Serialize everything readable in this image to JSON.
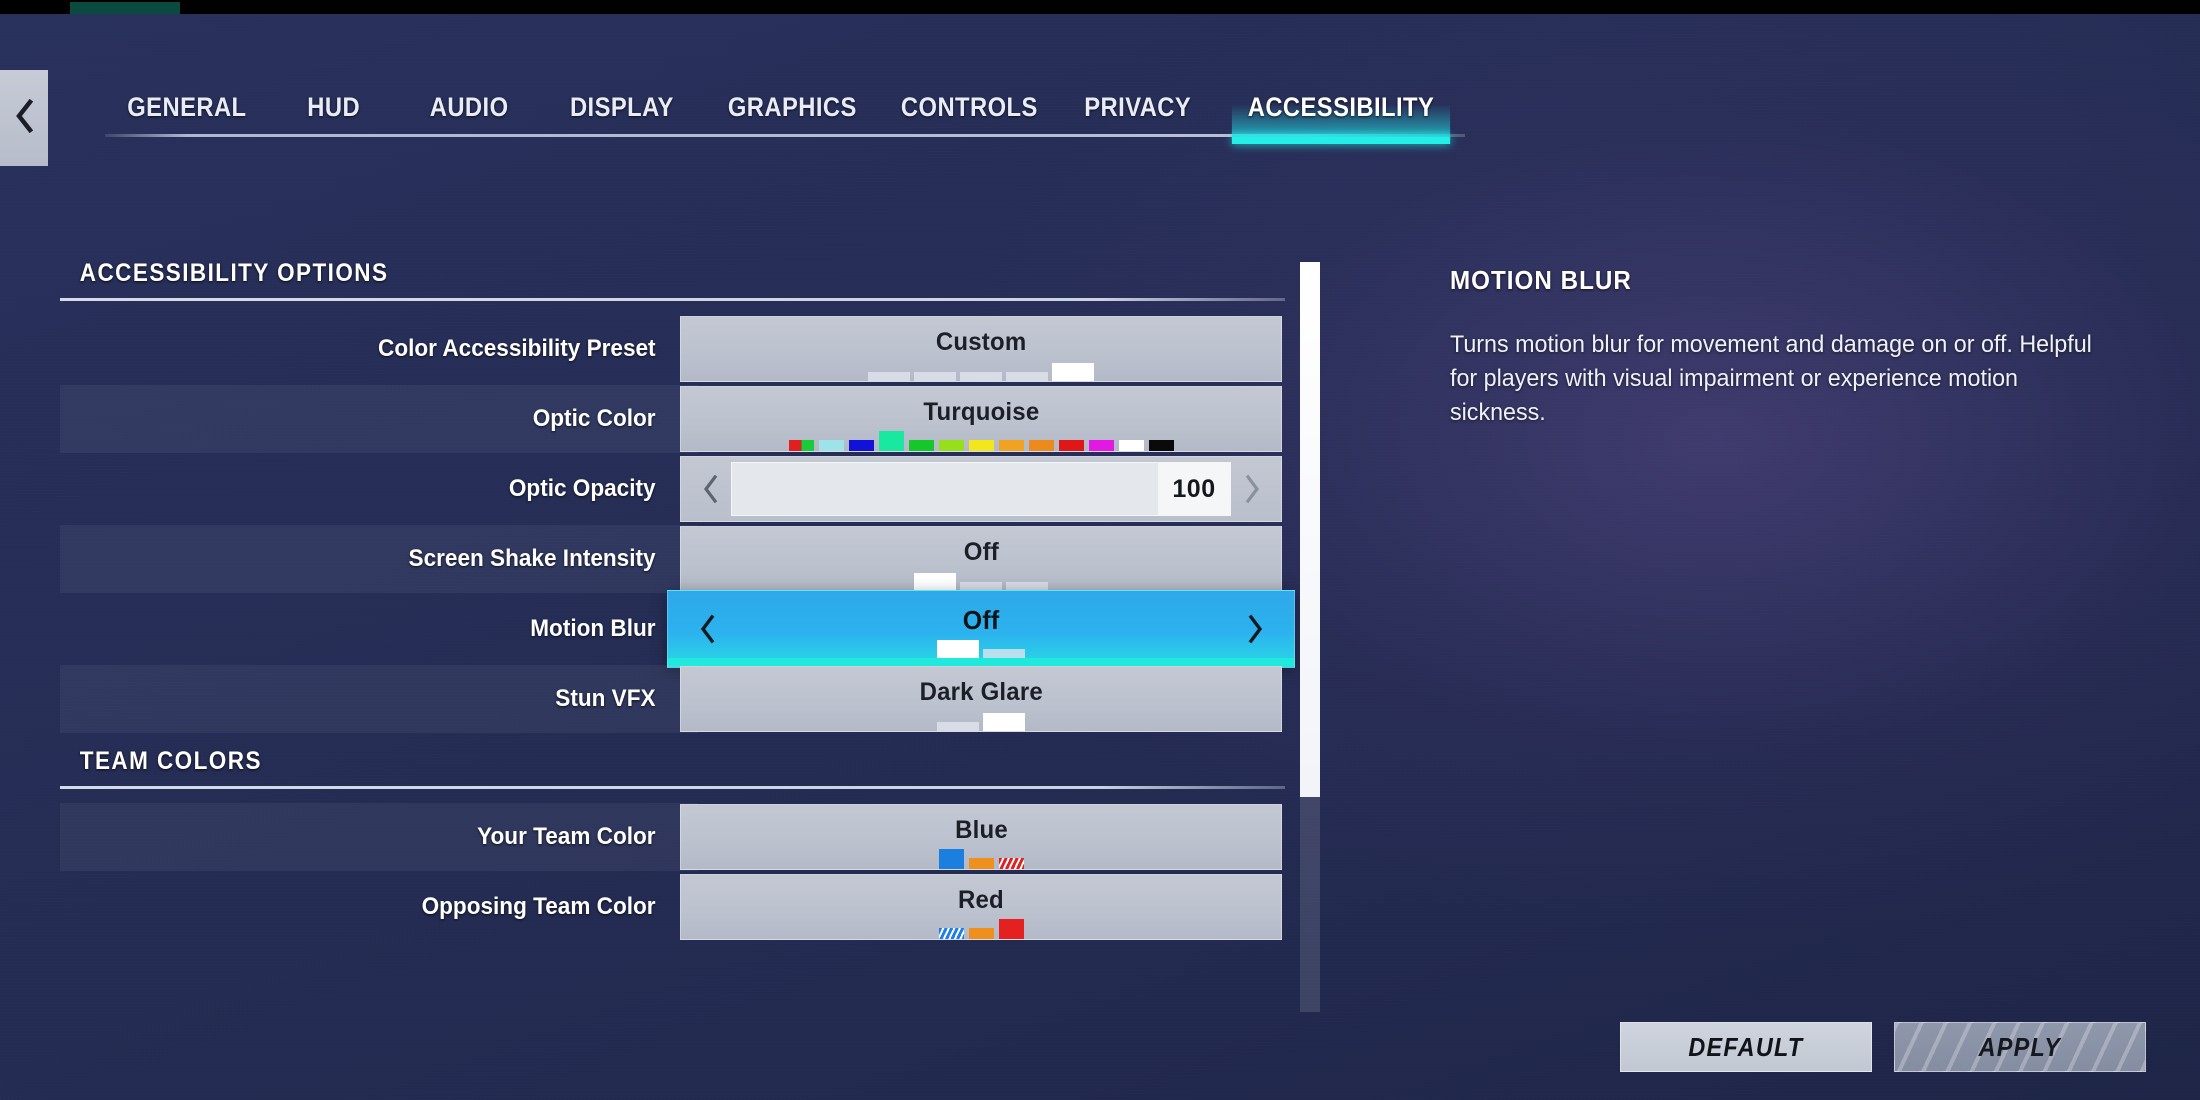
{
  "window": {
    "back_icon": "chevron-left-icon"
  },
  "tabs": [
    {
      "label": "GENERAL",
      "active": false
    },
    {
      "label": "HUD",
      "active": false
    },
    {
      "label": "AUDIO",
      "active": false
    },
    {
      "label": "DISPLAY",
      "active": false
    },
    {
      "label": "GRAPHICS",
      "active": false
    },
    {
      "label": "CONTROLS",
      "active": false
    },
    {
      "label": "PRIVACY",
      "active": false
    },
    {
      "label": "ACCESSIBILITY",
      "active": true
    }
  ],
  "sections": [
    {
      "title": "ACCESSIBILITY OPTIONS"
    },
    {
      "title": "TEAM COLORS"
    }
  ],
  "settings": {
    "color_preset": {
      "label": "Color Accessibility Preset",
      "value": "Custom",
      "steps": 5,
      "selected_step": 5
    },
    "optic_color": {
      "label": "Optic Color",
      "value": "Turquoise",
      "selected_index": 3,
      "swatches": [
        "split",
        "#9fe3ea",
        "#1111d8",
        "#19e8a0",
        "#16c72c",
        "#96e01b",
        "#f2e71c",
        "#f0a323",
        "#ec8a1e",
        "#e01717",
        "#e219e2",
        "#ffffff",
        "#0a0a0a"
      ]
    },
    "optic_opacity": {
      "label": "Optic Opacity",
      "value": "100",
      "fill_percent": 100,
      "left_arrow": "chevron-left-icon",
      "right_arrow": "chevron-right-icon"
    },
    "screen_shake": {
      "label": "Screen Shake Intensity",
      "value": "Off",
      "steps": 3,
      "selected_step": 1
    },
    "motion_blur": {
      "label": "Motion Blur",
      "value": "Off",
      "steps": 2,
      "selected_step": 1,
      "focused": true,
      "left_arrow": "chevron-left-icon",
      "right_arrow": "chevron-right-icon"
    },
    "stun_vfx": {
      "label": "Stun VFX",
      "value": "Dark Glare",
      "steps": 2,
      "selected_step": 2
    },
    "your_team_color": {
      "label": "Your Team Color",
      "value": "Blue",
      "selected_index": 0,
      "swatches": [
        "#1b7fe0",
        "#ef8f1d",
        "hatch-red"
      ]
    },
    "opposing_team_color": {
      "label": "Opposing Team Color",
      "value": "Red",
      "selected_index": 2,
      "swatches": [
        "hatch-blue",
        "#ef8f1d",
        "#e52020"
      ]
    }
  },
  "info": {
    "title": "MOTION BLUR",
    "body": "Turns motion blur for movement and damage on or off. Helpful for players with visual impairment or experience motion sickness."
  },
  "footer": {
    "default_label": "DEFAULT",
    "apply_label": "APPLY"
  },
  "colors": {
    "accent_cyan": "#22efe8",
    "highlight_blue": "#2ea8ea",
    "background_navy": "#262e57",
    "control_gray": "#bcc2ce"
  }
}
